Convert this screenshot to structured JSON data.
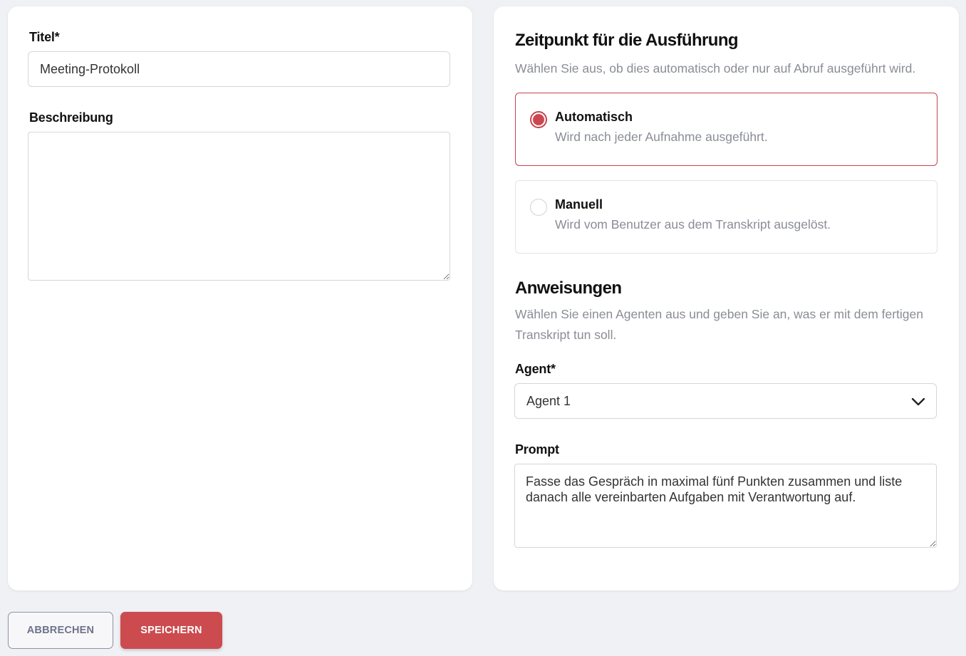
{
  "general": {
    "title_label": "Titel*",
    "title_value": "Meeting-Protokoll",
    "description_label": "Beschreibung",
    "description_value": ""
  },
  "execution": {
    "heading": "Zeitpunkt für die Ausführung",
    "subtitle": "Wählen Sie aus, ob dies automatisch oder nur auf Abruf ausgeführt wird.",
    "options": [
      {
        "title": "Automatisch",
        "description": "Wird nach jeder Aufnahme ausgeführt.",
        "selected": true
      },
      {
        "title": "Manuell",
        "description": "Wird vom Benutzer aus dem Transkript ausgelöst.",
        "selected": false
      }
    ]
  },
  "instructions": {
    "heading": "Anweisungen",
    "subtitle": "Wählen Sie einen Agenten aus und geben Sie an, was er mit dem fertigen Transkript tun soll.",
    "agent_label": "Agent*",
    "agent_value": "Agent 1",
    "prompt_label": "Prompt",
    "prompt_value": "Fasse das Gespräch in maximal fünf Punkten zusammen und liste danach alle vereinbarten Aufgaben mit Verantwortung auf."
  },
  "actions": {
    "cancel_label": "ABBRECHEN",
    "save_label": "SPEICHERN"
  },
  "colors": {
    "accent": "#cc4b4f",
    "background": "#f0f1f5",
    "card": "#ffffff",
    "muted_text": "#8a8d96"
  },
  "icons": {
    "select_toggle": "chevron-down-icon"
  }
}
